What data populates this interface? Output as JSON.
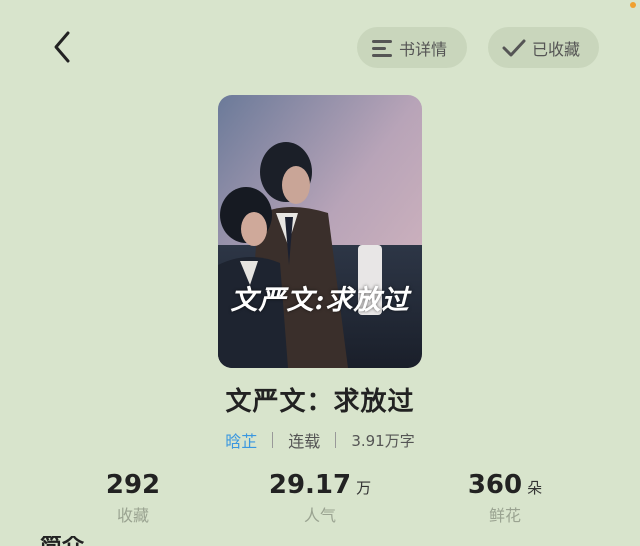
{
  "header": {
    "detail_label": "书详情",
    "favorited_label": "已收藏"
  },
  "cover": {
    "overlay_text": "文严文:求放过"
  },
  "book": {
    "title": "文严文：求放过",
    "author": "晗芷",
    "status": "连载",
    "word_count": "3.91万字"
  },
  "stats": {
    "favorites": {
      "value": "292",
      "unit": "",
      "label": "收藏"
    },
    "popularity": {
      "value": "29.17",
      "unit": "万",
      "label": "人气"
    },
    "flowers": {
      "value": "360",
      "unit": "朵",
      "label": "鲜花"
    }
  },
  "section": {
    "heading": "简介"
  },
  "colors": {
    "background": "#d8e4cc",
    "pill_bg": "#c9d6bc",
    "author_link": "#3a97e0",
    "label_gray": "#9aa391"
  },
  "icons": {
    "back": "chevron-left-icon",
    "detail": "list-icon",
    "favorited": "check-icon"
  }
}
